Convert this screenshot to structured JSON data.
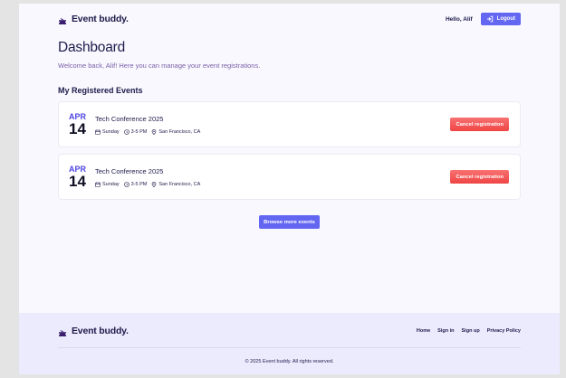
{
  "header": {
    "brand": "Event buddy.",
    "greeting": "Hello, Alif",
    "logout_label": "Logout"
  },
  "dashboard": {
    "title": "Dashboard",
    "welcome": "Welcome back, Alif! Here you can manage your event registrations.",
    "section_title": "My Registered Events"
  },
  "events": [
    {
      "month": "APR",
      "day": "14",
      "title": "Tech Conference 2025",
      "weekday": "Sunday",
      "time": "3-5 PM",
      "location": "San Francisco, CA",
      "action_label": "Cancel registration"
    },
    {
      "month": "APR",
      "day": "14",
      "title": "Tech Conference 2025",
      "weekday": "Sunday",
      "time": "3-5 PM",
      "location": "San Francisco, CA",
      "action_label": "Cancel registration"
    }
  ],
  "browse_label": "Browse more events",
  "footer": {
    "brand": "Event buddy.",
    "links": [
      "Home",
      "Sign in",
      "Sign up",
      "Privacy Policy"
    ],
    "copyright": "© 2025 Event buddy. All rights reserved."
  },
  "colors": {
    "accent": "#6366f1",
    "danger": "#ef4444",
    "month": "#4f46e5",
    "footer_bg": "#ebebfd",
    "page_bg": "#f8f8fe"
  },
  "icons": {
    "brand": "ticket-icon",
    "logout": "logout-icon",
    "weekday": "calendar-icon",
    "time": "clock-icon",
    "location": "map-pin-icon"
  }
}
